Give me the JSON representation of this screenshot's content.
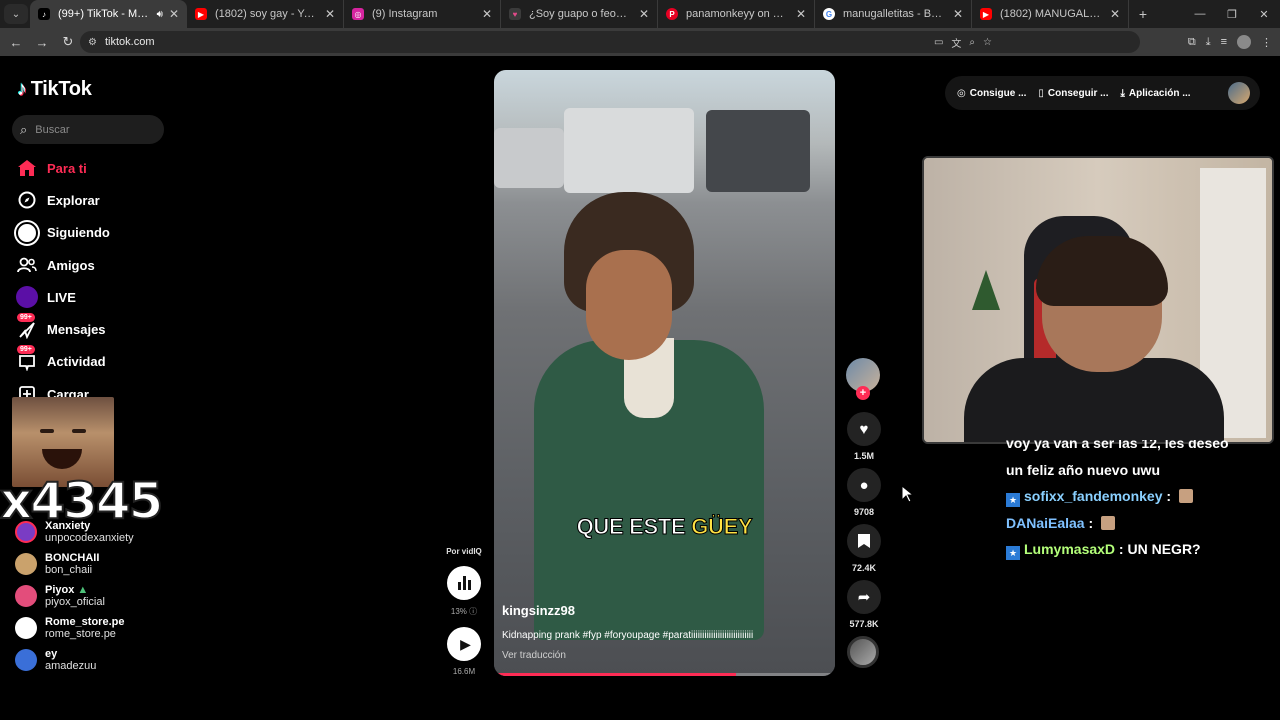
{
  "browser": {
    "tabs": [
      {
        "title": "(99+) TikTok - Make Your Da",
        "fav": "T",
        "fav_color": "#000000",
        "active": true
      },
      {
        "title": "(1802) soy gay - YouTube",
        "fav": "▶",
        "fav_color": "#ff0000",
        "active": false
      },
      {
        "title": "(9) Instagram",
        "fav": "◎",
        "fav_color": "#d6249f",
        "active": false
      },
      {
        "title": "¿Soy guapo o feo? Prueba de a",
        "fav": "♥",
        "fav_color": "#e24a8a",
        "active": false
      },
      {
        "title": "panamonkeyy on TikTok",
        "fav": "P",
        "fav_color": "#e60023",
        "active": false
      },
      {
        "title": "manugalletitas - Buscar con Go",
        "fav": "G",
        "fav_color": "#ffffff",
        "active": false
      },
      {
        "title": "(1802) MANUGALLETITA FACE",
        "fav": "▶",
        "fav_color": "#ff0000",
        "active": false
      }
    ],
    "url": "tiktok.com"
  },
  "tiktok": {
    "logo": "TikTok",
    "search_placeholder": "Buscar",
    "nav": [
      {
        "label": "Para ti",
        "icon": "home-icon",
        "active": true
      },
      {
        "label": "Explorar",
        "icon": "compass-icon",
        "active": false
      },
      {
        "label": "Siguiendo",
        "icon": "following-icon",
        "active": false
      },
      {
        "label": "Amigos",
        "icon": "friends-icon",
        "active": false
      },
      {
        "label": "LIVE",
        "icon": "live-icon",
        "active": false
      },
      {
        "label": "Mensajes",
        "icon": "messages-icon",
        "active": false,
        "badge": "99+"
      },
      {
        "label": "Actividad",
        "icon": "activity-icon",
        "active": false,
        "badge": "99+"
      },
      {
        "label": "Cargar",
        "icon": "upload-icon",
        "active": false
      }
    ],
    "following": [
      {
        "name": "Xanxiety",
        "handle": "unpocodexanxiety",
        "color": "#7a3cc4"
      },
      {
        "name": "BONCHAII",
        "handle": "bon_chaii",
        "color": "#caa26c"
      },
      {
        "name": "Piyox",
        "handle": "piyox_oficial",
        "color": "#e34d7b"
      },
      {
        "name": "Rome_store.pe",
        "handle": "rome_store.pe",
        "color": "#ffffff"
      },
      {
        "name": "ey",
        "handle": "amadezuu",
        "color": "#3a6fd8"
      }
    ]
  },
  "overlay": {
    "counter": "x4345"
  },
  "video": {
    "caption_prefix": "QUE ESTE",
    "caption_highlight": "GÜEY",
    "author": "kingsinzz98",
    "description": "Kidnapping prank #fyp #foryoupage #paratiiiiiiiiiiiiiiiiiiiiiiiiiiii",
    "translate": "Ver traducción",
    "progress": 0.71,
    "likes": "1.5M",
    "comments": "9708",
    "saves": "72.4K",
    "shares": "577.8K"
  },
  "vidiq": {
    "label": "Por vidIQ",
    "percent": "13%",
    "views": "16.6M"
  },
  "topright": {
    "coins": "Consigue ...",
    "device": "Conseguir ...",
    "app": "Aplicación ..."
  },
  "chat": {
    "cut_line": "voy ya van a ser las 12, les deseo",
    "line2": "un feliz año nuevo uwu",
    "messages": [
      {
        "user": "sofixx_fandemonkey",
        "text": ""
      },
      {
        "user": "DANaiEalaa",
        "text": ""
      },
      {
        "user": "LumymasaxD",
        "text": "UN NEGR?"
      }
    ]
  },
  "colors": {
    "accent": "#fe2c55",
    "caption_highlight": "#ffe243"
  }
}
